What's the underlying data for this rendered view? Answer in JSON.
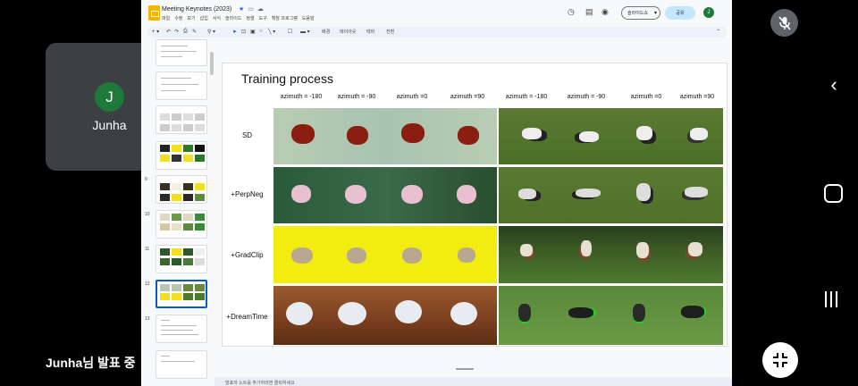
{
  "participant": {
    "initial": "J",
    "name": "Junha"
  },
  "presenting_label": "Junha님 발표 중",
  "doc": {
    "title": "Meeting Keynotes (2023)",
    "menu": [
      "파일",
      "수정",
      "보기",
      "삽입",
      "서식",
      "슬라이드",
      "정렬",
      "도구",
      "확장 프로그램",
      "도움말"
    ],
    "slideshow_label": "슬라이드쇼",
    "share_label": "공유",
    "user_initial": "J",
    "toolbar_texts": [
      "배경",
      "레이아웃",
      "테마",
      "전환"
    ],
    "notes_placeholder": "발표자 노트를 추가하려면 클릭하세요"
  },
  "filmstrip": {
    "numbers": [
      "9",
      "10",
      "11",
      "12",
      "13"
    ],
    "active_slide": "12"
  },
  "slide": {
    "title": "Training process",
    "columns": [
      "azimuth = -180",
      "azimuth = -90",
      "azimuth =0",
      "azimuth =90",
      "azimuth = -180",
      "azimuth = -90",
      "azimuth =0",
      "azimuth =90"
    ],
    "rows": [
      "SD",
      "+PerpNeg",
      "+GradClip",
      "+DreamTime"
    ]
  },
  "colors": {
    "accent_blue": "#0b57d0",
    "share_bg": "#c2e7ff",
    "avatar_green": "#1e7a3b",
    "tile_bg": "#3c4043"
  },
  "icons": [
    "audio-indicator-icon",
    "mic-off-icon",
    "back-icon",
    "home-icon",
    "recents-icon",
    "exit-fullscreen-icon",
    "star-icon",
    "folder-icon",
    "cloud-icon",
    "history-icon",
    "comment-icon",
    "video-icon"
  ]
}
